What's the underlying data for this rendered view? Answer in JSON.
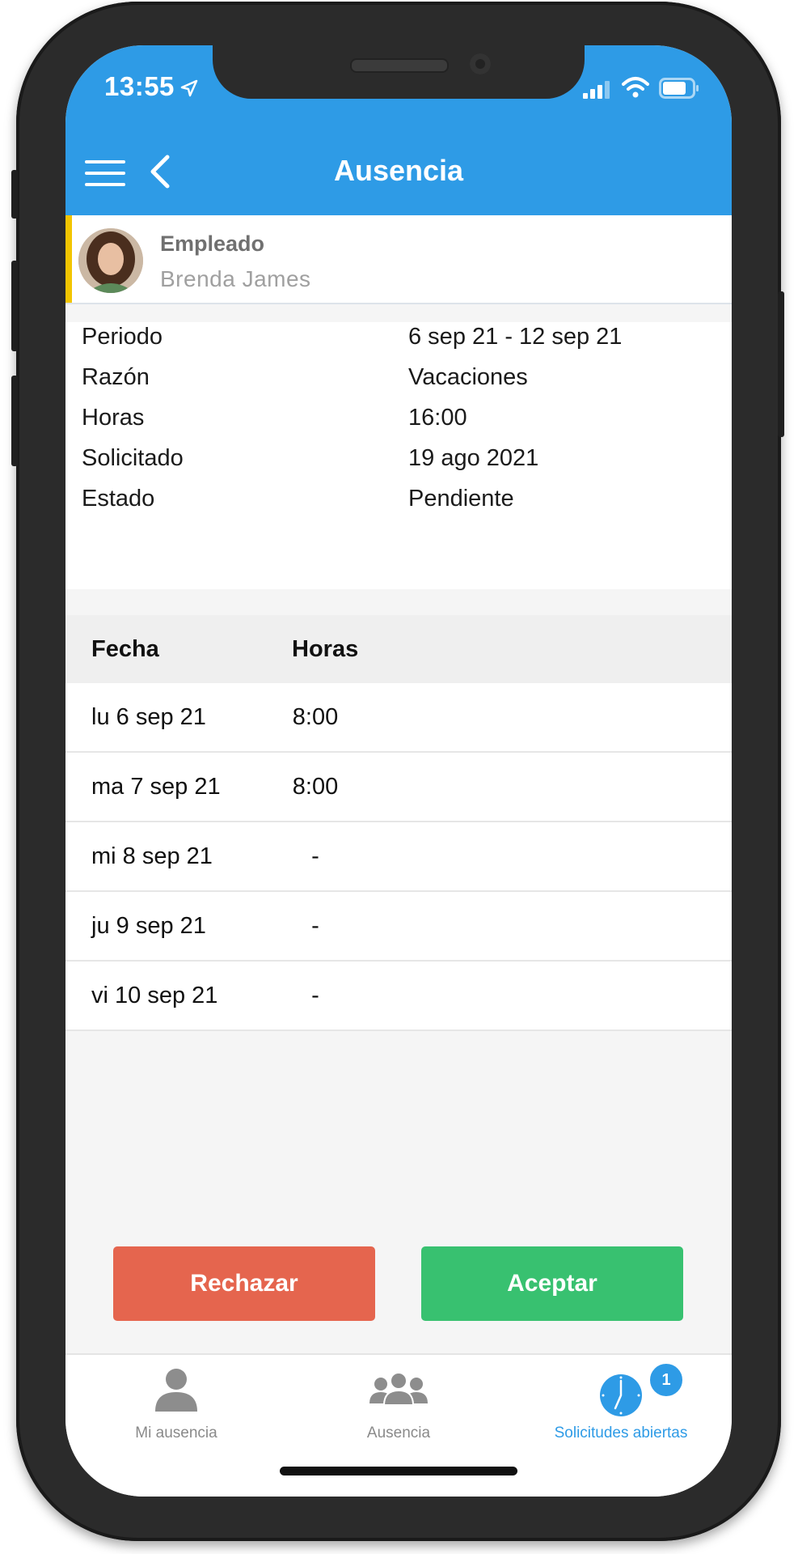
{
  "status_bar": {
    "time": "13:55"
  },
  "header": {
    "title": "Ausencia"
  },
  "employee": {
    "label": "Empleado",
    "name": "Brenda James"
  },
  "details": [
    {
      "key": "Periodo",
      "value": "6 sep 21 - 12 sep 21"
    },
    {
      "key": "Razón",
      "value": "Vacaciones"
    },
    {
      "key": "Horas",
      "value": "16:00"
    },
    {
      "key": "Solicitado",
      "value": "19 ago 2021"
    },
    {
      "key": "Estado",
      "value": "Pendiente"
    }
  ],
  "day_table": {
    "headers": {
      "date": "Fecha",
      "hours": "Horas"
    },
    "rows": [
      {
        "date": "lu 6 sep 21",
        "hours": "8:00"
      },
      {
        "date": "ma 7 sep 21",
        "hours": "8:00"
      },
      {
        "date": "mi 8 sep 21",
        "hours": "-"
      },
      {
        "date": "ju 9 sep 21",
        "hours": "-"
      },
      {
        "date": "vi 10 sep 21",
        "hours": "-"
      }
    ]
  },
  "actions": {
    "reject": "Rechazar",
    "accept": "Aceptar"
  },
  "tabs": {
    "my_absence": {
      "label": "Mi ausencia",
      "icon": "person-icon"
    },
    "absence": {
      "label": "Ausencia",
      "icon": "group-icon"
    },
    "open_requests": {
      "label": "Solicitudes abiertas",
      "icon": "clock-icon",
      "badge": "1",
      "active": true
    }
  },
  "colors": {
    "header_blue": "#2e9be6",
    "reject_red": "#e5654e",
    "accept_green": "#38c170",
    "employee_accent": "#f2c500"
  }
}
